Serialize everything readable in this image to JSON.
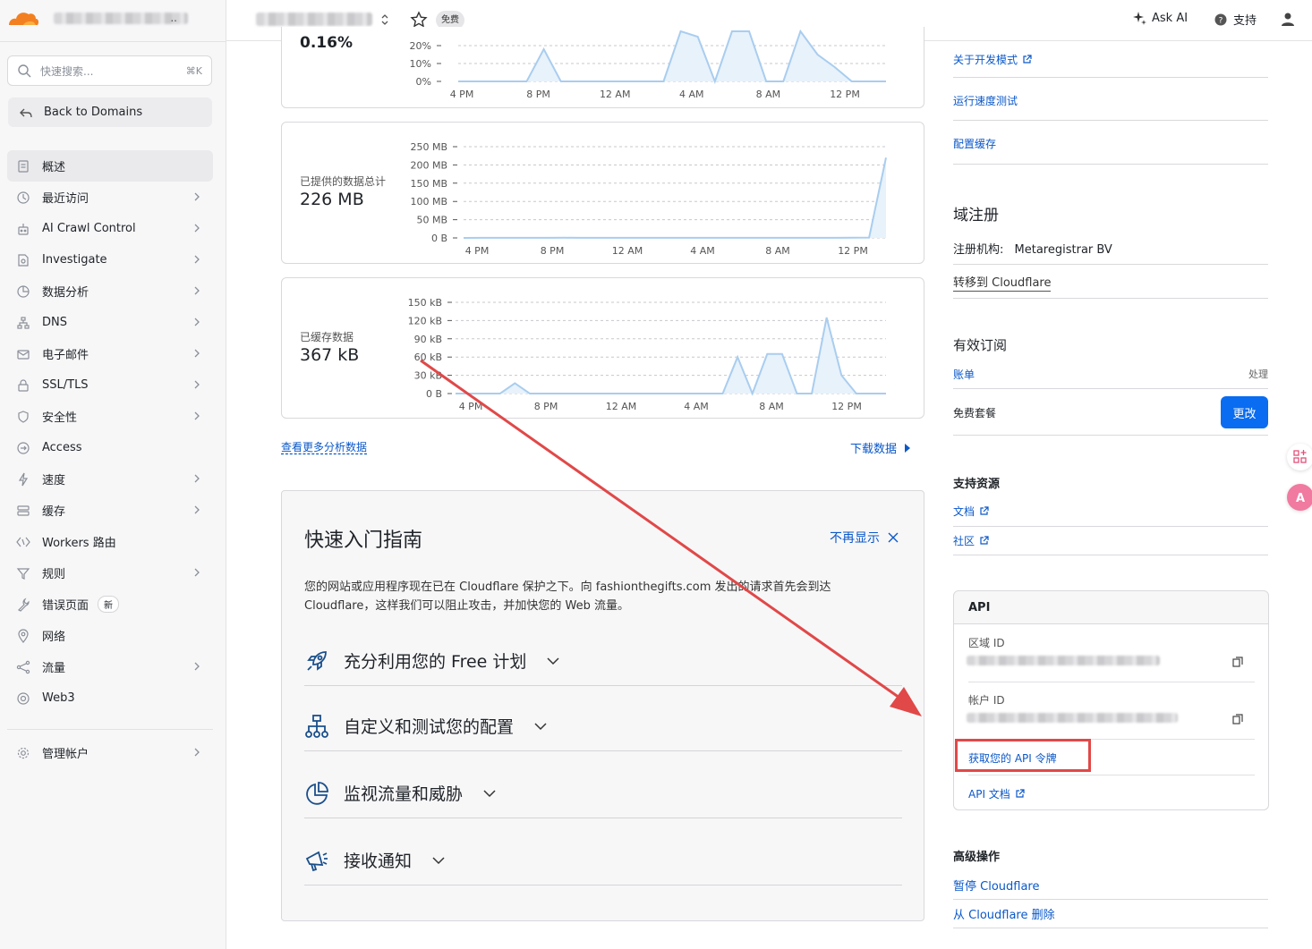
{
  "sidebar": {
    "account_suffix": "..",
    "search": {
      "placeholder": "快速搜索...",
      "shortcut": "⌘K"
    },
    "back_label": "Back to Domains",
    "items": [
      {
        "label": "概述",
        "chev": false
      },
      {
        "label": "最近访问",
        "chev": true
      },
      {
        "label": "AI Crawl Control",
        "chev": true
      },
      {
        "label": "Investigate",
        "chev": true
      },
      {
        "label": "数据分析",
        "chev": true
      },
      {
        "label": "DNS",
        "chev": true
      },
      {
        "label": "电子邮件",
        "chev": true
      },
      {
        "label": "SSL/TLS",
        "chev": true
      },
      {
        "label": "安全性",
        "chev": true
      },
      {
        "label": "Access",
        "chev": false
      },
      {
        "label": "速度",
        "chev": true
      },
      {
        "label": "缓存",
        "chev": true
      },
      {
        "label": "Workers 路由",
        "chev": false
      },
      {
        "label": "规则",
        "chev": true
      },
      {
        "label": "错误页面",
        "chev": false,
        "badge": "新"
      },
      {
        "label": "网络",
        "chev": false
      },
      {
        "label": "流量",
        "chev": true
      },
      {
        "label": "Web3",
        "chev": false
      }
    ],
    "manage_label": "管理帐户"
  },
  "topbar": {
    "plan_badge": "免费",
    "ask_ai": "Ask AI",
    "support": "支持"
  },
  "metrics": {
    "top_value_partial": "0.16%",
    "served_label": "已提供的数据总计",
    "served_value": "226 MB",
    "cached_label": "已缓存数据",
    "cached_value": "367 kB"
  },
  "chart_data": [
    {
      "type": "area",
      "title": "",
      "categories": [
        "4 PM",
        "8 PM",
        "12 AM",
        "4 AM",
        "8 AM",
        "12 PM"
      ],
      "yticks": [
        "20%",
        "10%",
        "0%"
      ],
      "ylim": [
        0,
        20
      ],
      "note": "partially visible chart (top cropped)",
      "values": [
        0,
        0,
        0,
        0,
        0,
        18,
        0,
        0,
        0,
        0,
        0,
        0,
        0,
        28,
        25,
        0,
        28,
        28,
        0,
        0,
        28,
        15,
        8,
        0,
        0,
        0
      ]
    },
    {
      "type": "area",
      "title": "已提供的数据总计",
      "categories": [
        "4 PM",
        "8 PM",
        "12 AM",
        "4 AM",
        "8 AM",
        "12 PM"
      ],
      "yticks": [
        "250 MB",
        "200 MB",
        "150 MB",
        "100 MB",
        "50 MB",
        "0 B"
      ],
      "ylim": [
        0,
        250
      ],
      "unit": "MB",
      "values": [
        0,
        0.2,
        0.3,
        0.2,
        0.2,
        0.2,
        0.5,
        0.3,
        0.2,
        0.2,
        0.3,
        0.2,
        0.2,
        0.2,
        0.2,
        0.2,
        0.2,
        0.2,
        0.3,
        0.3,
        0.2,
        0.2,
        0.2,
        0.5,
        1,
        220
      ]
    },
    {
      "type": "area",
      "title": "已缓存数据",
      "categories": [
        "4 PM",
        "8 PM",
        "12 AM",
        "4 AM",
        "8 AM",
        "12 PM"
      ],
      "yticks": [
        "150 kB",
        "120 kB",
        "90 kB",
        "60 kB",
        "30 kB",
        "0 B"
      ],
      "ylim": [
        0,
        150
      ],
      "unit": "kB",
      "values": [
        0,
        0,
        0,
        0,
        17,
        0,
        0,
        0,
        0,
        0,
        0,
        0,
        0,
        0,
        0,
        0,
        0,
        0,
        0,
        60,
        0,
        65,
        65,
        0,
        0,
        125,
        30,
        0,
        0,
        0
      ]
    }
  ],
  "links": {
    "more_analytics": "查看更多分析数据",
    "download": "下载数据"
  },
  "guide": {
    "title": "快速入门指南",
    "dismiss": "不再显示",
    "desc": "您的网站或应用程序现在已在 Cloudflare 保护之下。向 fashionthegifts.com 发出的请求首先会到达 Cloudflare，这样我们可以阻止攻击，并加快您的 Web 流量。",
    "sections": [
      "充分利用您的 Free 计划",
      "自定义和测试您的配置",
      "监视流量和威胁",
      "接收通知"
    ]
  },
  "right": {
    "dev_mode": "关于开发模式",
    "speed_test": "运行速度测试",
    "config_cache": "配置缓存",
    "registration": {
      "heading": "域注册",
      "registrar_label": "注册机构:",
      "registrar_value": "Metaregistrar BV",
      "transfer": "转移到 Cloudflare"
    },
    "subscriptions": {
      "heading": "有效订阅",
      "billing": "账单",
      "handle": "处理",
      "plan": "免费套餐",
      "change": "更改"
    },
    "support": {
      "heading": "支持资源",
      "docs": "文档",
      "community": "社区"
    },
    "api": {
      "title": "API",
      "zone_id_label": "区域 ID",
      "account_id_label": "帐户 ID",
      "get_token": "获取您的 API 令牌",
      "api_docs": "API 文档"
    },
    "advanced": {
      "heading": "高级操作",
      "pause": "暂停 Cloudflare",
      "remove": "从 Cloudflare 删除"
    }
  },
  "colors": {
    "accent": "#0b58c9",
    "primary_button": "#0a6cf0",
    "chart_line": "#a9cdef",
    "chart_fill": "#e8f2fb",
    "annotation": "#e14848"
  }
}
